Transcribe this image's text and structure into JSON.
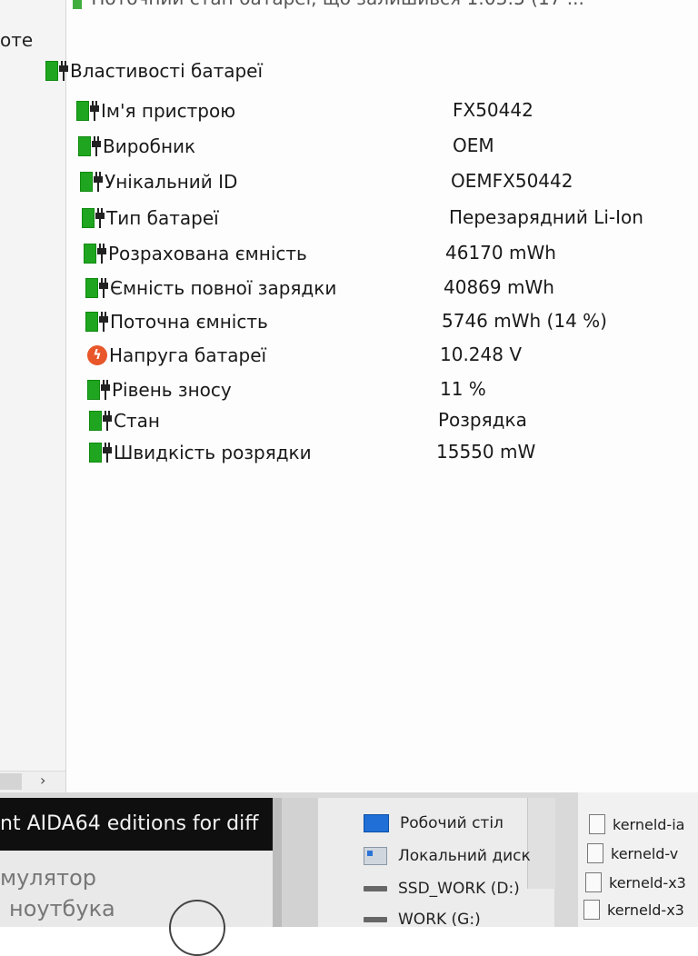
{
  "left_pane": {
    "label": "оте"
  },
  "top_row": {
    "text": "Поточний стан батареї, що залишився   1:03:5 (17 ..."
  },
  "tree": {
    "header": "Властивості батареї",
    "rows": [
      {
        "label": "Ім'я пристрою",
        "value": "FX50442",
        "icon": "battery-icon"
      },
      {
        "label": "Виробник",
        "value": "OEM",
        "icon": "battery-icon"
      },
      {
        "label": "Унікальний ID",
        "value": "OEMFX50442",
        "icon": "battery-icon"
      },
      {
        "label": "Тип батареї",
        "value": "Перезарядний Li-Ion",
        "icon": "battery-icon"
      },
      {
        "label": "Розрахована ємність",
        "value": "46170 mWh",
        "icon": "battery-icon"
      },
      {
        "label": "Ємність повної зарядки",
        "value": "40869 mWh",
        "icon": "battery-icon"
      },
      {
        "label": "Поточна ємність",
        "value": "5746 mWh  (14 %)",
        "icon": "battery-icon"
      },
      {
        "label": "Напруга батареї",
        "value": "10.248 V",
        "icon": "voltage-warning-icon"
      },
      {
        "label": "Рівень зносу",
        "value": "11 %",
        "icon": "battery-icon"
      },
      {
        "label": "Стан",
        "value": "Розрядка",
        "icon": "battery-icon"
      },
      {
        "label": "Швидкість розрядки",
        "value": "15550 mW",
        "icon": "battery-icon"
      }
    ]
  },
  "browser": {
    "title": "nt AIDA64 editions for diff",
    "line1": "мулятор",
    "line2": "ноутбука"
  },
  "explorer": {
    "drives": [
      {
        "label": "Робочий стіл",
        "icon": "desktop-icon"
      },
      {
        "label": "Локальний диск",
        "icon": "local-disk-icon"
      },
      {
        "label": "SSD_WORK (D:)",
        "icon": "drive-icon"
      },
      {
        "label": "WORK (G:)",
        "icon": "drive-icon"
      }
    ]
  },
  "files": {
    "items": [
      {
        "label": "kerneld-ia",
        "icon": "file-icon"
      },
      {
        "label": "kerneld-v",
        "icon": "file-icon"
      },
      {
        "label": "kerneld-x3",
        "icon": "file-icon"
      },
      {
        "label": "kerneld-x3",
        "icon": "file-icon"
      }
    ]
  }
}
